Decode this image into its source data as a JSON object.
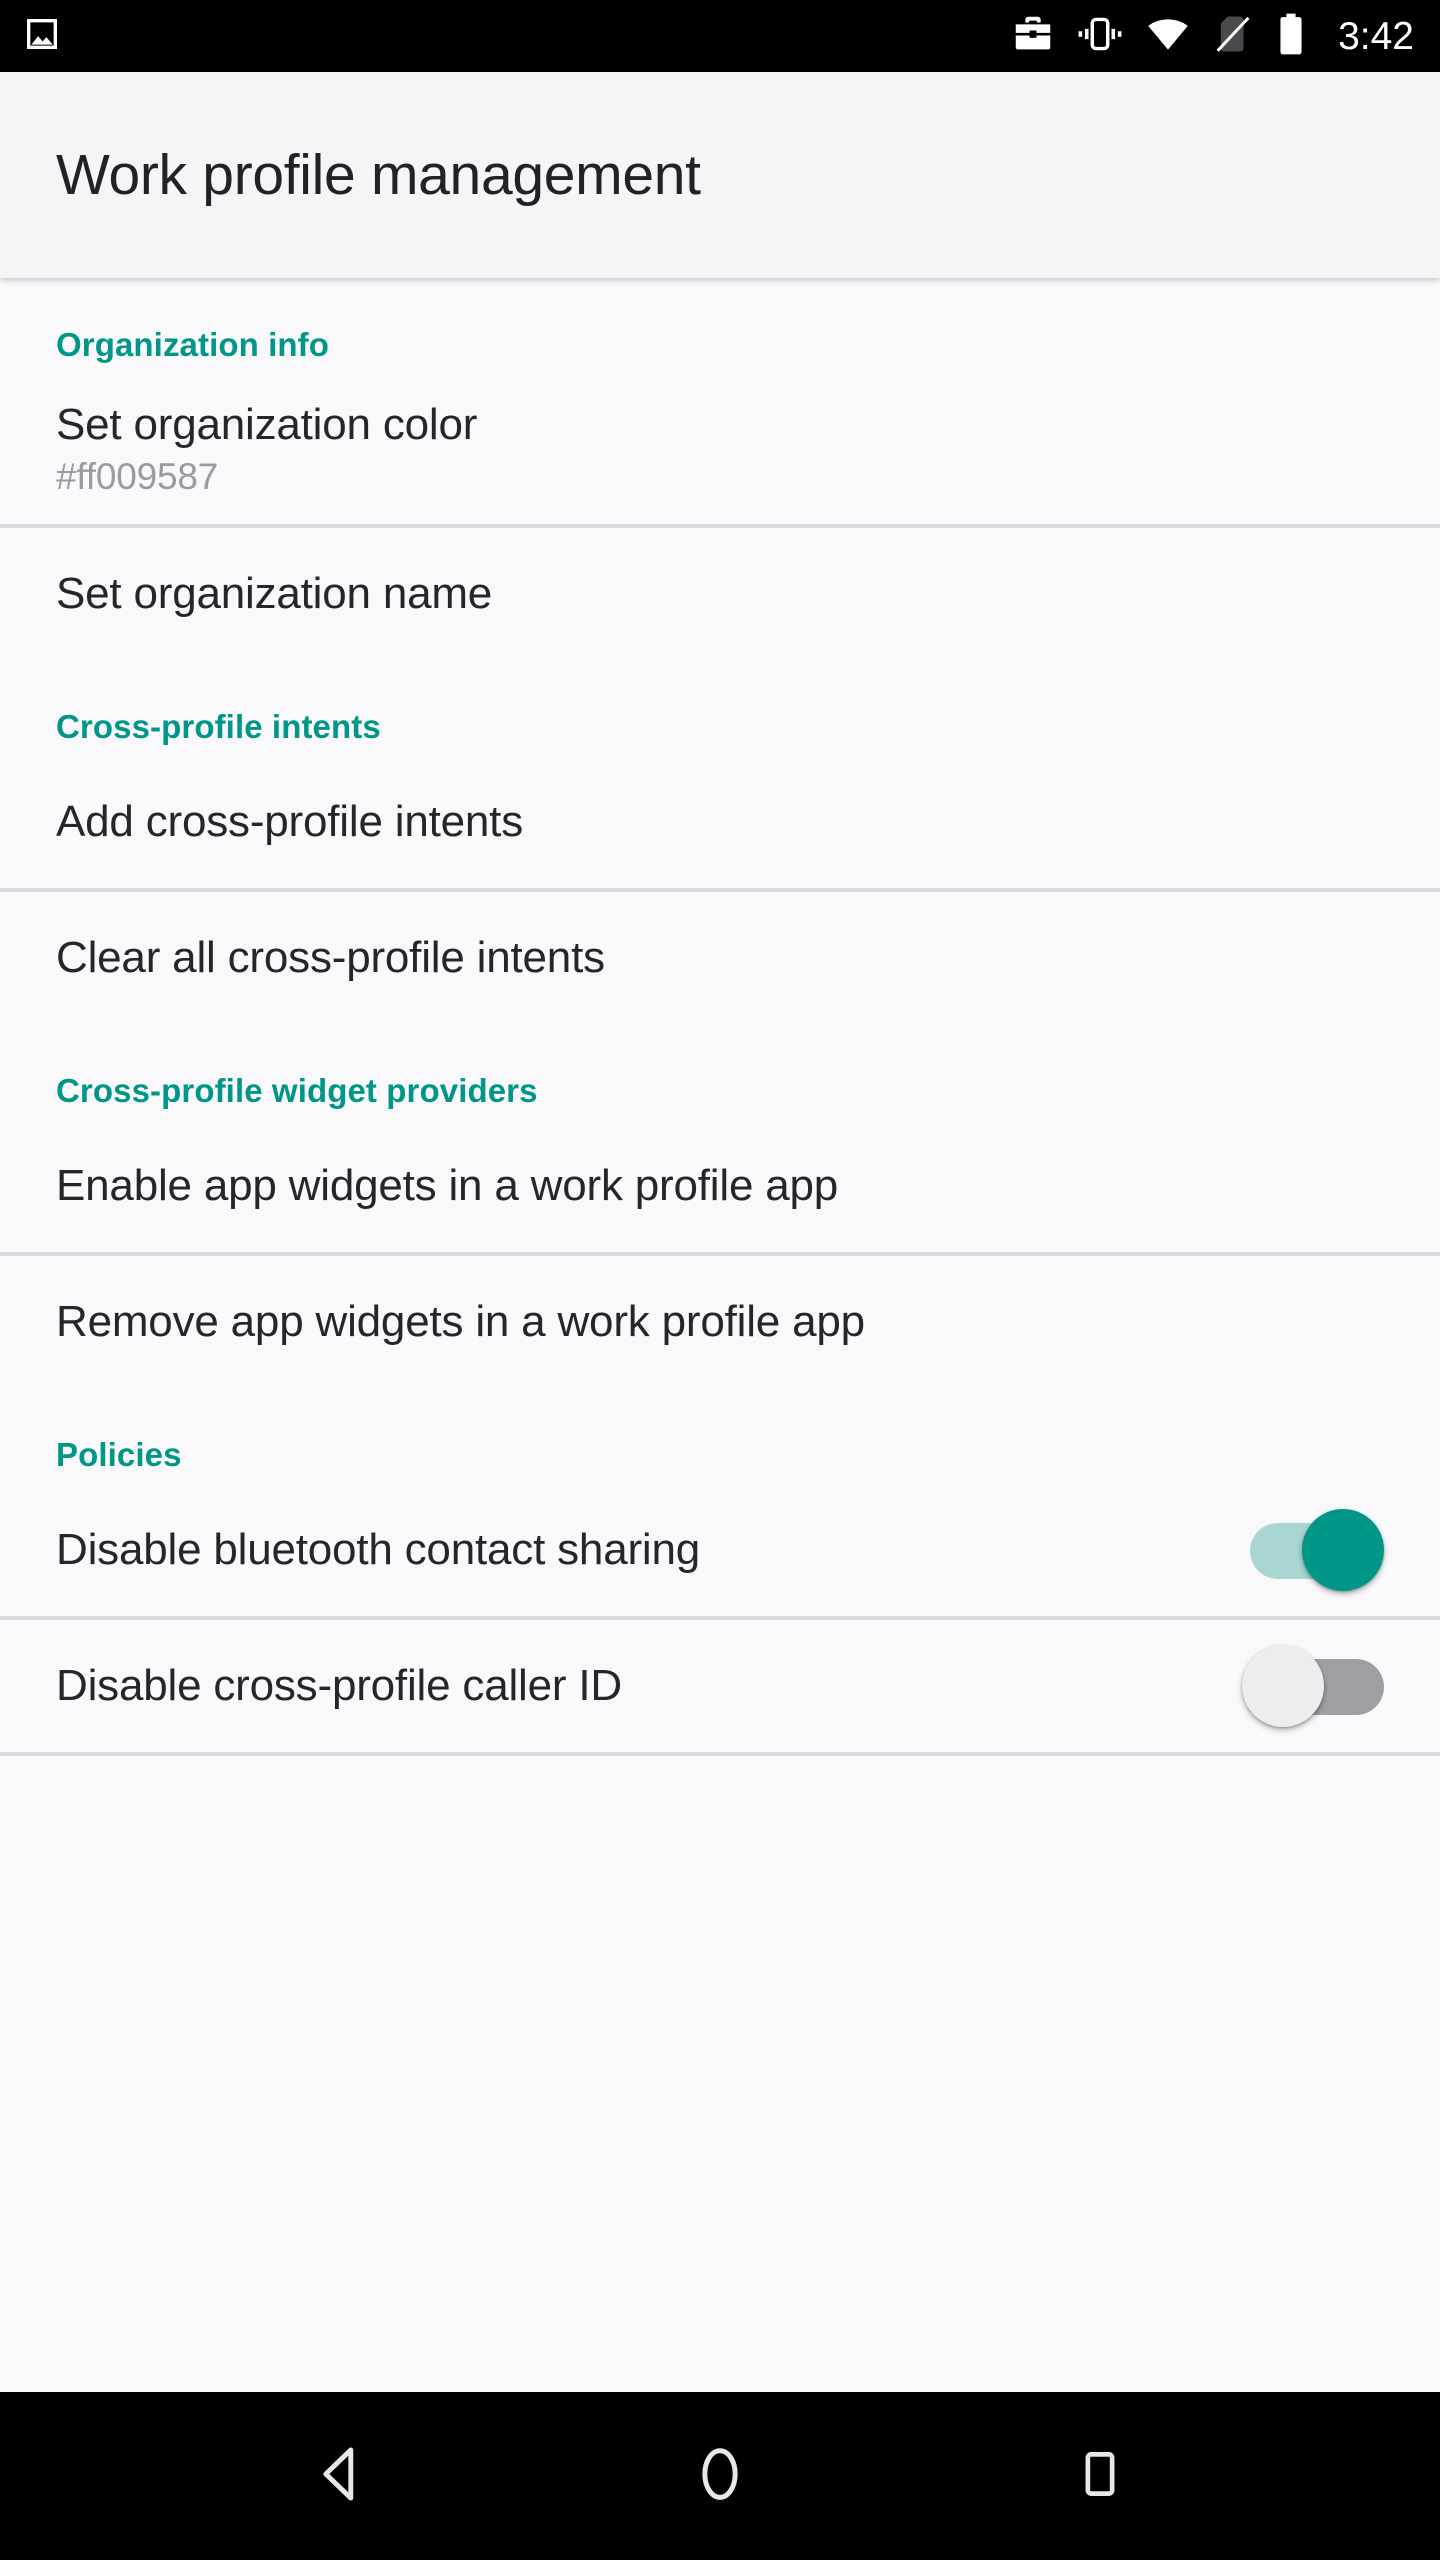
{
  "status_bar": {
    "left_icons": [
      {
        "name": "image-icon"
      }
    ],
    "right_icons": [
      {
        "name": "work-briefcase-icon"
      },
      {
        "name": "vibrate-icon"
      },
      {
        "name": "wifi-icon"
      },
      {
        "name": "no-sim-icon"
      },
      {
        "name": "battery-full-icon"
      }
    ],
    "clock": "3:42"
  },
  "header": {
    "title": "Work profile management"
  },
  "colors": {
    "accent": "#009688",
    "section_header": "#009688",
    "switch_on_thumb": "#009688",
    "switch_on_track": "#a9d6d0",
    "switch_off_track": "#9e9ea3",
    "switch_off_thumb": "#ededf0",
    "background": "#f9f8fb",
    "title_bar": "#f5f4f7",
    "divider": "#d8d7dc",
    "primary_text": "#26262a",
    "secondary_text": "#9a9a9f",
    "status_bar": "#000000",
    "nav_bar": "#000000"
  },
  "sections": [
    {
      "header": "Organization info",
      "rows": [
        {
          "title": "Set organization color",
          "summary": "#ff009587",
          "control": "none"
        },
        {
          "title": "Set organization name",
          "summary": "",
          "control": "none"
        }
      ]
    },
    {
      "header": "Cross-profile intents",
      "rows": [
        {
          "title": "Add cross-profile intents",
          "summary": "",
          "control": "none"
        },
        {
          "title": "Clear all cross-profile intents",
          "summary": "",
          "control": "none"
        }
      ]
    },
    {
      "header": "Cross-profile widget providers",
      "rows": [
        {
          "title": "Enable app widgets in a work profile app",
          "summary": "",
          "control": "none"
        },
        {
          "title": "Remove app widgets in a work profile app",
          "summary": "",
          "control": "none"
        }
      ]
    },
    {
      "header": "Policies",
      "rows": [
        {
          "title": "Disable bluetooth contact sharing",
          "summary": "",
          "control": "switch",
          "switch_state": "on"
        },
        {
          "title": "Disable cross-profile caller ID",
          "summary": "",
          "control": "switch",
          "switch_state": "off"
        }
      ]
    }
  ],
  "nav_bar": {
    "buttons": [
      {
        "name": "back-icon",
        "label": "Back"
      },
      {
        "name": "home-icon",
        "label": "Home"
      },
      {
        "name": "recents-icon",
        "label": "Recents"
      }
    ]
  }
}
